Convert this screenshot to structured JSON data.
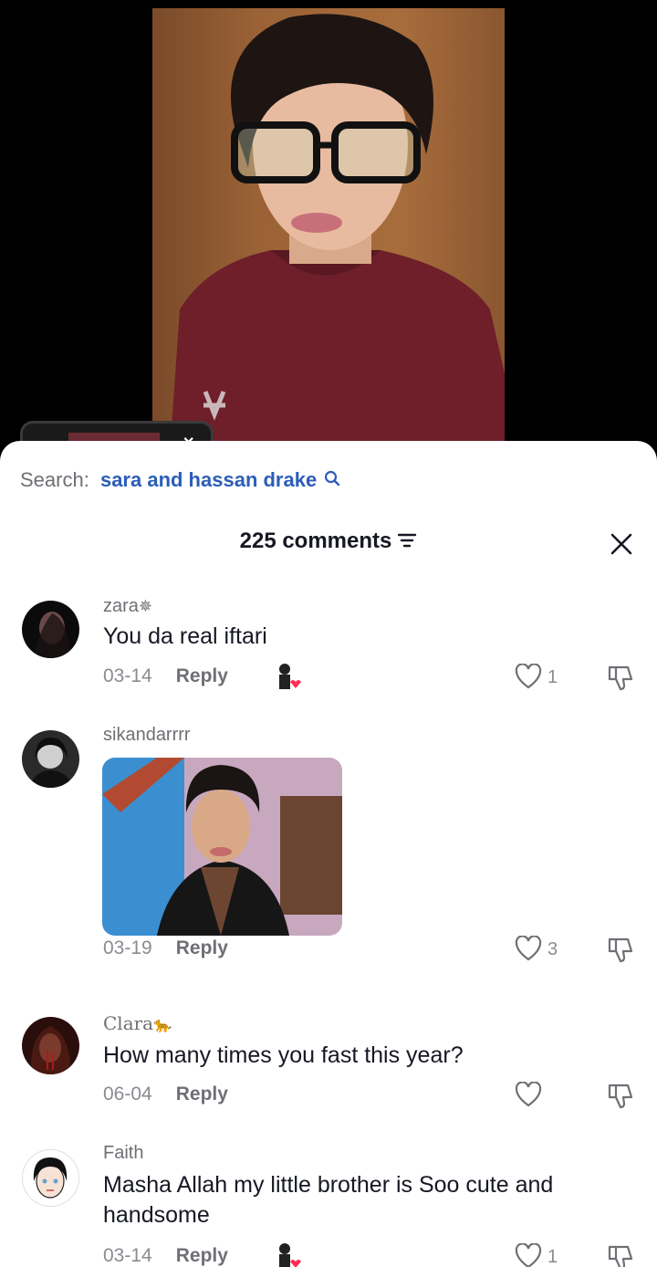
{
  "video": {
    "description": "video of person"
  },
  "search": {
    "label": "Search:",
    "query": "sara and hassan drake"
  },
  "header": {
    "count_label": "225 comments"
  },
  "comments": [
    {
      "username": "zara",
      "text": "You da real iftari",
      "date": "03-14",
      "reply": "Reply",
      "likes": "1",
      "creator_liked": true
    },
    {
      "username": "sikandarrrr",
      "text": "",
      "date": "03-19",
      "reply": "Reply",
      "likes": "3",
      "creator_liked": false,
      "has_photo": true
    },
    {
      "username": "Clara",
      "text": "How many times you fast this year?",
      "date": "06-04",
      "reply": "Reply",
      "likes": "",
      "creator_liked": false
    },
    {
      "username": "Faith",
      "text": "Masha Allah my little brother is Soo cute and handsome",
      "date": "03-14",
      "reply": "Reply",
      "likes": "1",
      "creator_liked": true
    }
  ],
  "colors": {
    "accent_link": "#2b5db8",
    "like_heart": "#fe2c55"
  }
}
